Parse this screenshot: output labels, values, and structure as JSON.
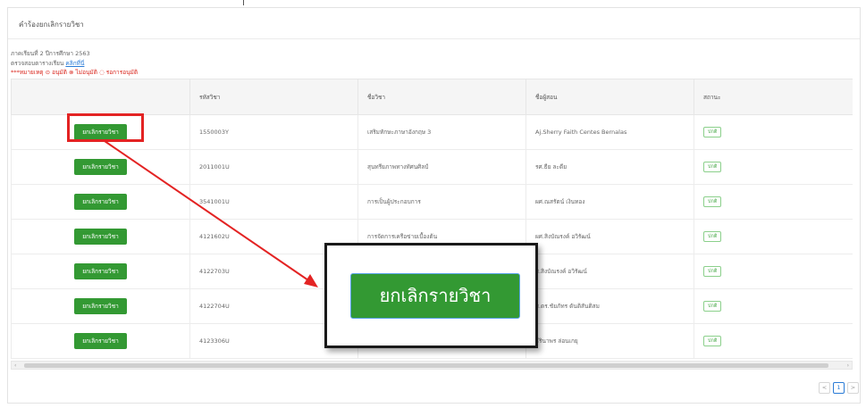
{
  "card": {
    "title": "คำร้องยกเลิกรายวิชา"
  },
  "info": {
    "semester_line": "ภาคเรียนที่ 2 ปีการศึกษา 2563",
    "check_schedule_prefix": "ตรวจสอบตารางเรียน",
    "check_schedule_link": "คลิกที่นี่",
    "legend_line": "***หมายเหตุ ⊙ อนุมัติ ⊗ ไม่อนุมัติ ◌ รอการอนุมัติ"
  },
  "table": {
    "headers": [
      "",
      "รหัสวิชา",
      "ชื่อวิชา",
      "ชื่อผู้สอน",
      "สถานะ"
    ],
    "rows": [
      {
        "action": "ยกเลิกรายวิชา",
        "code": "1550003Y",
        "name": "เสริมทักษะภาษาอังกฤษ 3",
        "teacher": "Aj.Sherry Faith Centes Bernalas",
        "status": "ปกติ"
      },
      {
        "action": "ยกเลิกรายวิชา",
        "code": "2011001U",
        "name": "สุนทรียภาพทางทัศนศิลป์",
        "teacher": "รศ.ธีย ละดีย",
        "status": "ปกติ"
      },
      {
        "action": "ยกเลิกรายวิชา",
        "code": "3541001U",
        "name": "การเป็นผู้ประกอบการ",
        "teacher": "ผศ.ณสรัตน์ เงินทอง",
        "status": "ปกติ"
      },
      {
        "action": "ยกเลิกรายวิชา",
        "code": "4121602U",
        "name": "การจัดการเครือข่ายเบื้องต้น",
        "teacher": "ผศ.สิงบัณรงค์ อวิรัฒน์",
        "status": "ปกติ"
      },
      {
        "action": "ยกเลิกรายวิชา",
        "code": "4122703U",
        "name": "",
        "teacher": "ส.สิงบัณรงค์ อวิรัฒน์",
        "status": "ปกติ"
      },
      {
        "action": "ยกเลิกรายวิชา",
        "code": "4122704U",
        "name": "",
        "teacher": "ส.ดร.ชัยภัทร ดันติสันติสม",
        "status": "ปกติ"
      },
      {
        "action": "ยกเลิกรายวิชา",
        "code": "4123306U",
        "name": "",
        "teacher": "ธีรินาพร ล่อนเกยุ",
        "status": "ปกติ"
      }
    ]
  },
  "scrollbar": {
    "left_arrow": "‹",
    "right_arrow": "›"
  },
  "pager": {
    "prev": "<",
    "current": "1",
    "next": ">"
  },
  "zoom": {
    "button_label": "ยกเลิกรายวิชา"
  },
  "colors": {
    "button_green": "#339933",
    "highlight_red": "#e32323",
    "link_blue": "#2a7bd6"
  }
}
